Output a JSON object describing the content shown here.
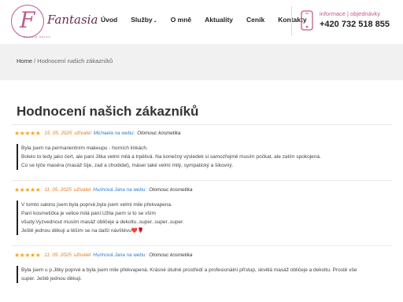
{
  "brand": {
    "logo_letter": "F",
    "logo_name": "Fantasia",
    "logo_sub": "beauty salon",
    "accent": "#c05a8c"
  },
  "nav": {
    "items": [
      {
        "label": "Úvod"
      },
      {
        "label": "Služby"
      },
      {
        "label": "O mně"
      },
      {
        "label": "Aktuality"
      },
      {
        "label": "Ceník"
      },
      {
        "label": "Kontakty"
      }
    ]
  },
  "contact": {
    "label": "informace | objednávky",
    "phone": "+420 732 518 855",
    "icon": "phone-icon"
  },
  "breadcrumb": {
    "home": "Home",
    "separator": " / ",
    "current": "Hodnocení našich zákazníků"
  },
  "page": {
    "title": "Hodnocení našich zákazníků"
  },
  "reviews": [
    {
      "stars": "★★★★★",
      "date": "15. 05. 2025",
      "user_label": "uživatel",
      "user": "Michaela na webu:",
      "category": "Olomouc kosmetika",
      "lines": [
        "Byla jsem na permanentním makeupu - horních linkách.",
        "Bolelo to tedy jako čert, ale paní Jitka velmi milá a trpělivá. Na konečný výsledek si samozřejmě musím počkat, ale zatím spokojená.",
        "Co se týče maséra (masáž šíje, zad a chodidel), máser také velmi milý, sympatický a šikovný."
      ]
    },
    {
      "stars": "★★★★★",
      "date": "11. 05. 2025",
      "user_label": "uživatel",
      "user": "Hurinová Jana na webu:",
      "category": "Olomouc kosmetika",
      "lines": [
        "V tomto salonu jsem byla poprvé,byla jsem velmi mile překvapena.",
        "Paní kosmetička je velice milá paní.Užila jsem si to se vším",
        "všudy.Vyzvednout musím masáž obličeje a dekoltu..super..super..super.",
        "Ještě jednou děkuji a těším se na další návštěvu❤️🌹"
      ]
    },
    {
      "stars": "★★★★★",
      "date": "11. 05. 2025",
      "user_label": "uživatel",
      "user": "Hurinová Jana na webu:",
      "category": "Olomouc kosmetika",
      "lines": [
        "Byla jsem u p.Jitky poprvé a byla jsem mile překvapená. Krásné útulné prostředí a profesionální přístup, skvělá masáž obličeje a dekoltu. Prostě vše",
        "super. Ještě jednou děkuji."
      ]
    }
  ],
  "colors": {
    "star": "#f5a623",
    "date": "#e07d22",
    "link": "#2d7bd1",
    "breadcrumb_bg": "#f1f1f1"
  }
}
